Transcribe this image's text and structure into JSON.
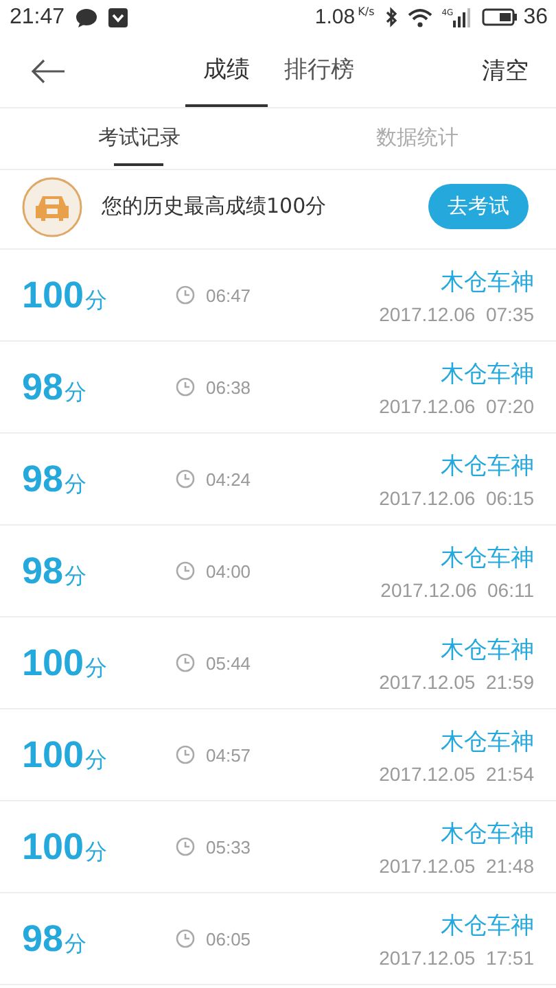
{
  "status_bar": {
    "time": "21:47",
    "speed": "1.08",
    "speed_unit": "K/s",
    "network": "4G",
    "battery": "36"
  },
  "header": {
    "tabs": [
      {
        "label": "成绩",
        "selected": true
      },
      {
        "label": "排行榜",
        "selected": false
      }
    ],
    "action": "清空"
  },
  "subtabs": [
    {
      "label": "考试记录",
      "selected": true
    },
    {
      "label": "数据统计",
      "selected": false
    }
  ],
  "banner": {
    "text": "您的历史最高成绩100分",
    "button": "去考试"
  },
  "records": [
    {
      "score": "100",
      "unit": "分",
      "duration": "06:47",
      "name": "木仓车神",
      "date": "2017.12.06  07:35"
    },
    {
      "score": "98",
      "unit": "分",
      "duration": "06:38",
      "name": "木仓车神",
      "date": "2017.12.06  07:20"
    },
    {
      "score": "98",
      "unit": "分",
      "duration": "04:24",
      "name": "木仓车神",
      "date": "2017.12.06  06:15"
    },
    {
      "score": "98",
      "unit": "分",
      "duration": "04:00",
      "name": "木仓车神",
      "date": "2017.12.06  06:11"
    },
    {
      "score": "100",
      "unit": "分",
      "duration": "05:44",
      "name": "木仓车神",
      "date": "2017.12.05  21:59"
    },
    {
      "score": "100",
      "unit": "分",
      "duration": "04:57",
      "name": "木仓车神",
      "date": "2017.12.05  21:54"
    },
    {
      "score": "100",
      "unit": "分",
      "duration": "05:33",
      "name": "木仓车神",
      "date": "2017.12.05  21:48"
    },
    {
      "score": "98",
      "unit": "分",
      "duration": "06:05",
      "name": "木仓车神",
      "date": "2017.12.05  17:51"
    }
  ]
}
